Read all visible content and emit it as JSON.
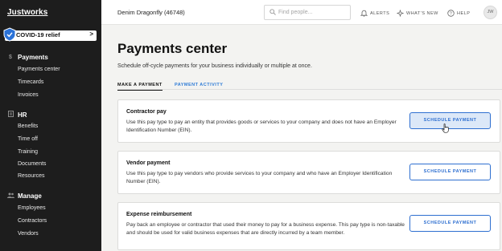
{
  "sidebar": {
    "logo": "Justworks",
    "covid_label": "COVID-19 relief",
    "covid_chevron": ">",
    "sections": [
      {
        "title": "Payments",
        "icon": "dollar-icon",
        "items": [
          "Payments center",
          "Timecards",
          "Invoices"
        ]
      },
      {
        "title": "HR",
        "icon": "document-icon",
        "items": [
          "Benefits",
          "Time off",
          "Training",
          "Documents",
          "Resources"
        ]
      },
      {
        "title": "Manage",
        "icon": "people-icon",
        "items": [
          "Employees",
          "Contractors",
          "Vendors"
        ]
      }
    ]
  },
  "topbar": {
    "company": "Denim Dragonfly (46748)",
    "search_placeholder": "Find people...",
    "alerts": "ALERTS",
    "whats_new": "WHAT'S NEW",
    "help": "HELP",
    "avatar_initials": "JW"
  },
  "main": {
    "title": "Payments center",
    "subtitle": "Schedule off-cycle payments for your business individually or multiple at once.",
    "tabs": [
      {
        "label": "MAKE A PAYMENT",
        "active": true
      },
      {
        "label": "PAYMENT ACTIVITY",
        "active": false
      }
    ],
    "cards": [
      {
        "title": "Contractor pay",
        "description": "Use this pay type to pay an entity that provides goods or services to your company and does not have an Employer Identification Number (EIN).",
        "button": "SCHEDULE PAYMENT"
      },
      {
        "title": "Vendor payment",
        "description": "Use this pay type to pay vendors who provide services to your company and who have an Employer Identification Number (EIN).",
        "button": "SCHEDULE PAYMENT"
      },
      {
        "title": "Expense reimbursement",
        "description": "Pay back an employee or contractor that used their money to pay for a business expense. This pay type is non-taxable and should be used for valid business expenses that are directly incurred by a team member.",
        "button": "SCHEDULE PAYMENT"
      }
    ]
  },
  "colors": {
    "sidebar_bg": "#1d1d1d",
    "accent": "#2e6fd0",
    "page_bg": "#f3f3f1"
  }
}
